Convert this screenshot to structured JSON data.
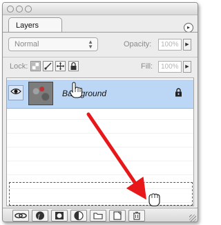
{
  "window": {
    "tab_label": "Layers",
    "menu_glyph": "▸"
  },
  "blend": {
    "mode": "Normal",
    "opacity_label": "Opacity:",
    "opacity_value": "100%"
  },
  "lock": {
    "label": "Lock:",
    "fill_label": "Fill:",
    "fill_value": "100%"
  },
  "layers": [
    {
      "name": "Background",
      "visible": true,
      "locked": true,
      "selected": true
    }
  ],
  "colors": {
    "selection": "#bcd6f5",
    "arrow": "#e8181a"
  },
  "icons": {
    "eye": "eye-icon",
    "lock": "lock-icon",
    "hand_cursor": "hand-cursor-icon",
    "trash": "trash-icon"
  }
}
